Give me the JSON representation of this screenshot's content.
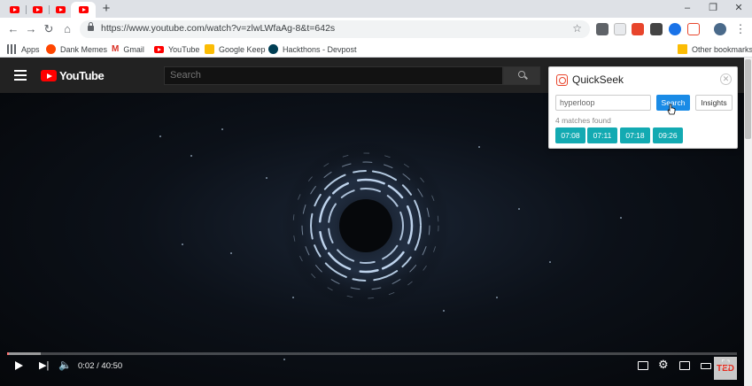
{
  "browser": {
    "tabs": [
      {
        "icon": "youtube-icon",
        "active": false
      },
      {
        "icon": "youtube-icon",
        "active": false
      },
      {
        "icon": "youtube-icon",
        "active": false
      },
      {
        "icon": "youtube-icon",
        "active": true
      }
    ],
    "new_tab_label": "+",
    "url": "https://www.youtube.com/watch?v=zlwLWfaAg-8&t=642s",
    "window_controls": {
      "minimize": "–",
      "maximize": "❐",
      "close": "✕"
    }
  },
  "bookmarks": {
    "items": [
      {
        "label": "Apps",
        "icon": "apps-grid-icon",
        "color": "#5f6368"
      },
      {
        "label": "Dank Memes",
        "icon": "reddit-icon",
        "color": "#ff4500"
      },
      {
        "label": "Gmail",
        "icon": "gmail-icon",
        "color": "#d93025"
      },
      {
        "label": "YouTube",
        "icon": "youtube-icon",
        "color": "#ff0000"
      },
      {
        "label": "Google Keep",
        "icon": "keep-icon",
        "color": "#fbbc04"
      },
      {
        "label": "Hackthons - Devpost",
        "icon": "devpost-icon",
        "color": "#003e54"
      }
    ],
    "other": "Other bookmarks"
  },
  "youtube": {
    "logo_text": "YouTube",
    "search_placeholder": "Search",
    "player": {
      "time": "0:02 / 40:50",
      "progress_fraction": 0.0008,
      "badge": "TED"
    }
  },
  "quickseek": {
    "title": "QuickSeek",
    "close": "✕",
    "query": "hyperloop",
    "search_label": "Search",
    "insights_label": "Insights",
    "match_count": "4 matches found",
    "timestamps": [
      "07:08",
      "07:11",
      "07:18",
      "09:26"
    ],
    "accent": "#1a8be6",
    "timestamp_color": "#13aab2"
  }
}
